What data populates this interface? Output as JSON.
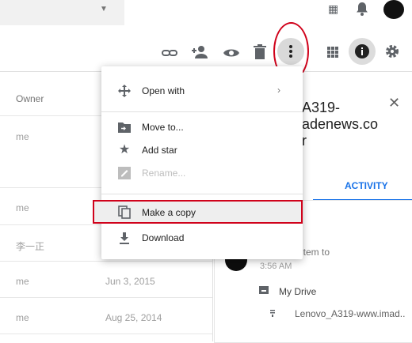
{
  "toolbar": {
    "icons": [
      "link-icon",
      "add-person-icon",
      "preview-eye-icon",
      "trash-icon",
      "more-vert-icon",
      "grid-view-icon",
      "info-icon",
      "settings-gear-icon"
    ]
  },
  "file_list": {
    "owner_header": "Owner",
    "rows": [
      {
        "owner": "me",
        "modified": ""
      },
      {
        "owner": "me",
        "modified": ""
      },
      {
        "owner": "李一正",
        "modified": ""
      },
      {
        "owner": "me",
        "modified": "Jun 3, 2015"
      },
      {
        "owner": "me",
        "modified": "Aug 25, 2014"
      }
    ]
  },
  "details": {
    "title_line1": "A319-",
    "title_line2": "adenews.co",
    "title_line3": "r",
    "tab_activity": "ACTIVITY",
    "activity_text": "n item to",
    "activity_time": "3:56 AM",
    "activity_location": "My Drive",
    "activity_file": "Lenovo_A319-www.imad.."
  },
  "menu": {
    "open_with": "Open with",
    "move_to": "Move to...",
    "add_star": "Add star",
    "rename": "Rename...",
    "make_copy": "Make a copy",
    "download": "Download"
  },
  "colors": {
    "accent": "#1a73e8",
    "highlight_border": "#d0021b"
  }
}
